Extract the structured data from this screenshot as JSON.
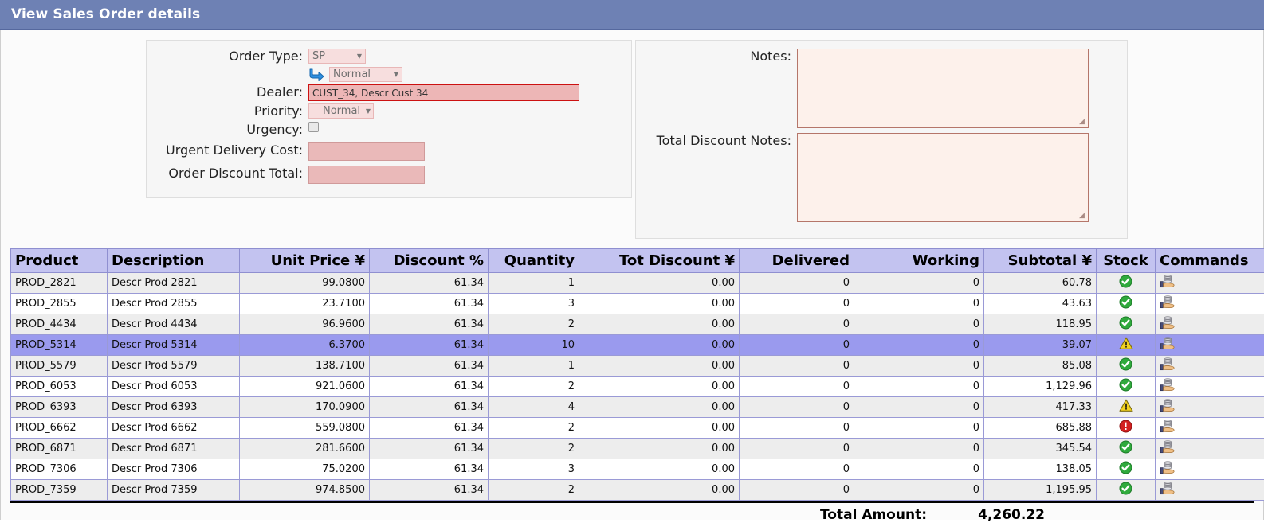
{
  "window": {
    "title": "View Sales Order details",
    "titlebar_color": "#6e81b4"
  },
  "form": {
    "order_type": {
      "label": "Order Type:",
      "value": "SP",
      "sub_icon": "forward-arrow-icon",
      "sub_value": "Normal"
    },
    "dealer": {
      "label": "Dealer:",
      "value": "CUST_34, Descr Cust 34",
      "placeholder": "",
      "border_color": "#cc1111",
      "fill_color": "#edb6b6"
    },
    "priority": {
      "label": "Priority:",
      "value": "—Normal"
    },
    "urgency": {
      "label": "Urgency:",
      "checked": false
    },
    "urgent_delivery_cost": {
      "label": "Urgent Delivery Cost:",
      "value": "",
      "fill_color": "#eab9b9"
    },
    "order_discount_total": {
      "label": "Order Discount Total:",
      "value": "",
      "fill_color": "#eab9b9"
    },
    "notes": {
      "label": "Notes:",
      "value": "",
      "fill_color": "#fdf1eb"
    },
    "total_discount_notes": {
      "label": "Total Discount Notes:",
      "value": "",
      "fill_color": "#fdf1eb"
    }
  },
  "table": {
    "columns": [
      "Product",
      "Description",
      "Unit Price ¥",
      "Discount %",
      "Quantity",
      "Tot Discount ¥",
      "Delivered",
      "Working",
      "Subtotal ¥",
      "Stock",
      "Commands"
    ],
    "header_bg": "#c3c3f0",
    "selected_row_index": 3,
    "command_icon": "sell-stock-icon",
    "rows": [
      {
        "product": "PROD_2821",
        "description": "Descr Prod 2821",
        "unit_price": "99.0800",
        "discount": "61.34",
        "quantity": "1",
        "tot_discount": "0.00",
        "delivered": "0",
        "working": "0",
        "subtotal": "60.78",
        "stock": "ok"
      },
      {
        "product": "PROD_2855",
        "description": "Descr Prod 2855",
        "unit_price": "23.7100",
        "discount": "61.34",
        "quantity": "3",
        "tot_discount": "0.00",
        "delivered": "0",
        "working": "0",
        "subtotal": "43.63",
        "stock": "ok"
      },
      {
        "product": "PROD_4434",
        "description": "Descr Prod 4434",
        "unit_price": "96.9600",
        "discount": "61.34",
        "quantity": "2",
        "tot_discount": "0.00",
        "delivered": "0",
        "working": "0",
        "subtotal": "118.95",
        "stock": "ok"
      },
      {
        "product": "PROD_5314",
        "description": "Descr Prod 5314",
        "unit_price": "6.3700",
        "discount": "61.34",
        "quantity": "10",
        "tot_discount": "0.00",
        "delivered": "0",
        "working": "0",
        "subtotal": "39.07",
        "stock": "warning"
      },
      {
        "product": "PROD_5579",
        "description": "Descr Prod 5579",
        "unit_price": "138.7100",
        "discount": "61.34",
        "quantity": "1",
        "tot_discount": "0.00",
        "delivered": "0",
        "working": "0",
        "subtotal": "85.08",
        "stock": "ok"
      },
      {
        "product": "PROD_6053",
        "description": "Descr Prod 6053",
        "unit_price": "921.0600",
        "discount": "61.34",
        "quantity": "2",
        "tot_discount": "0.00",
        "delivered": "0",
        "working": "0",
        "subtotal": "1,129.96",
        "stock": "ok"
      },
      {
        "product": "PROD_6393",
        "description": "Descr Prod 6393",
        "unit_price": "170.0900",
        "discount": "61.34",
        "quantity": "4",
        "tot_discount": "0.00",
        "delivered": "0",
        "working": "0",
        "subtotal": "417.33",
        "stock": "warning"
      },
      {
        "product": "PROD_6662",
        "description": "Descr Prod 6662",
        "unit_price": "559.0800",
        "discount": "61.34",
        "quantity": "2",
        "tot_discount": "0.00",
        "delivered": "0",
        "working": "0",
        "subtotal": "685.88",
        "stock": "error"
      },
      {
        "product": "PROD_6871",
        "description": "Descr Prod 6871",
        "unit_price": "281.6600",
        "discount": "61.34",
        "quantity": "2",
        "tot_discount": "0.00",
        "delivered": "0",
        "working": "0",
        "subtotal": "345.54",
        "stock": "ok"
      },
      {
        "product": "PROD_7306",
        "description": "Descr Prod 7306",
        "unit_price": "75.0200",
        "discount": "61.34",
        "quantity": "3",
        "tot_discount": "0.00",
        "delivered": "0",
        "working": "0",
        "subtotal": "138.05",
        "stock": "ok"
      },
      {
        "product": "PROD_7359",
        "description": "Descr Prod 7359",
        "unit_price": "974.8500",
        "discount": "61.34",
        "quantity": "2",
        "tot_discount": "0.00",
        "delivered": "0",
        "working": "0",
        "subtotal": "1,195.95",
        "stock": "ok"
      }
    ]
  },
  "totals": {
    "label": "Total Amount:",
    "value": "4,260.22"
  },
  "status_colors": {
    "ok": "#2faa3c",
    "warning": "#f2d21e",
    "error": "#d32020"
  }
}
